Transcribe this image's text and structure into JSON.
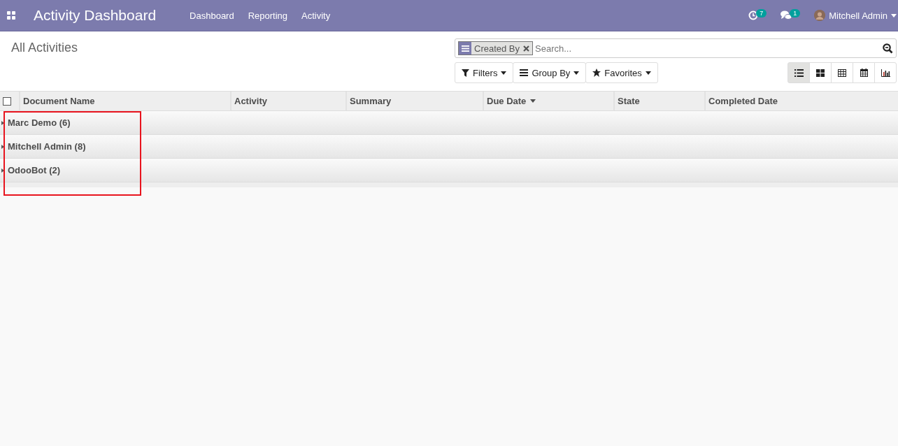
{
  "navbar": {
    "app_title": "Activity Dashboard",
    "menu": [
      "Dashboard",
      "Reporting",
      "Activity"
    ],
    "activity_count": "7",
    "message_count": "1",
    "user": "Mitchell Admin"
  },
  "control_panel": {
    "breadcrumb": "All Activities",
    "facet": {
      "label": "Created By"
    },
    "search": {
      "placeholder": "Search..."
    },
    "filter_buttons": [
      {
        "kind": "filter",
        "label": "Filters"
      },
      {
        "kind": "groupby",
        "label": "Group By"
      },
      {
        "kind": "favorites",
        "label": "Favorites"
      }
    ],
    "view_switcher": [
      {
        "kind": "list",
        "selected": true
      },
      {
        "kind": "kanban",
        "selected": false
      },
      {
        "kind": "pivot",
        "selected": false
      },
      {
        "kind": "calendar",
        "selected": false
      },
      {
        "kind": "graph",
        "selected": false
      }
    ]
  },
  "table": {
    "select_all_checked": false,
    "columns": [
      {
        "label": "Document Name",
        "sorted": false
      },
      {
        "label": "Activity",
        "sorted": false
      },
      {
        "label": "Summary",
        "sorted": false
      },
      {
        "label": "Due Date",
        "sorted": true
      },
      {
        "label": "State",
        "sorted": false
      },
      {
        "label": "Completed Date",
        "sorted": false
      }
    ],
    "groups": [
      {
        "label": "Marc Demo (6)",
        "expanded": false
      },
      {
        "label": "Mitchell Admin (8)",
        "expanded": false
      },
      {
        "label": "OdooBot (2)",
        "expanded": false
      }
    ]
  }
}
